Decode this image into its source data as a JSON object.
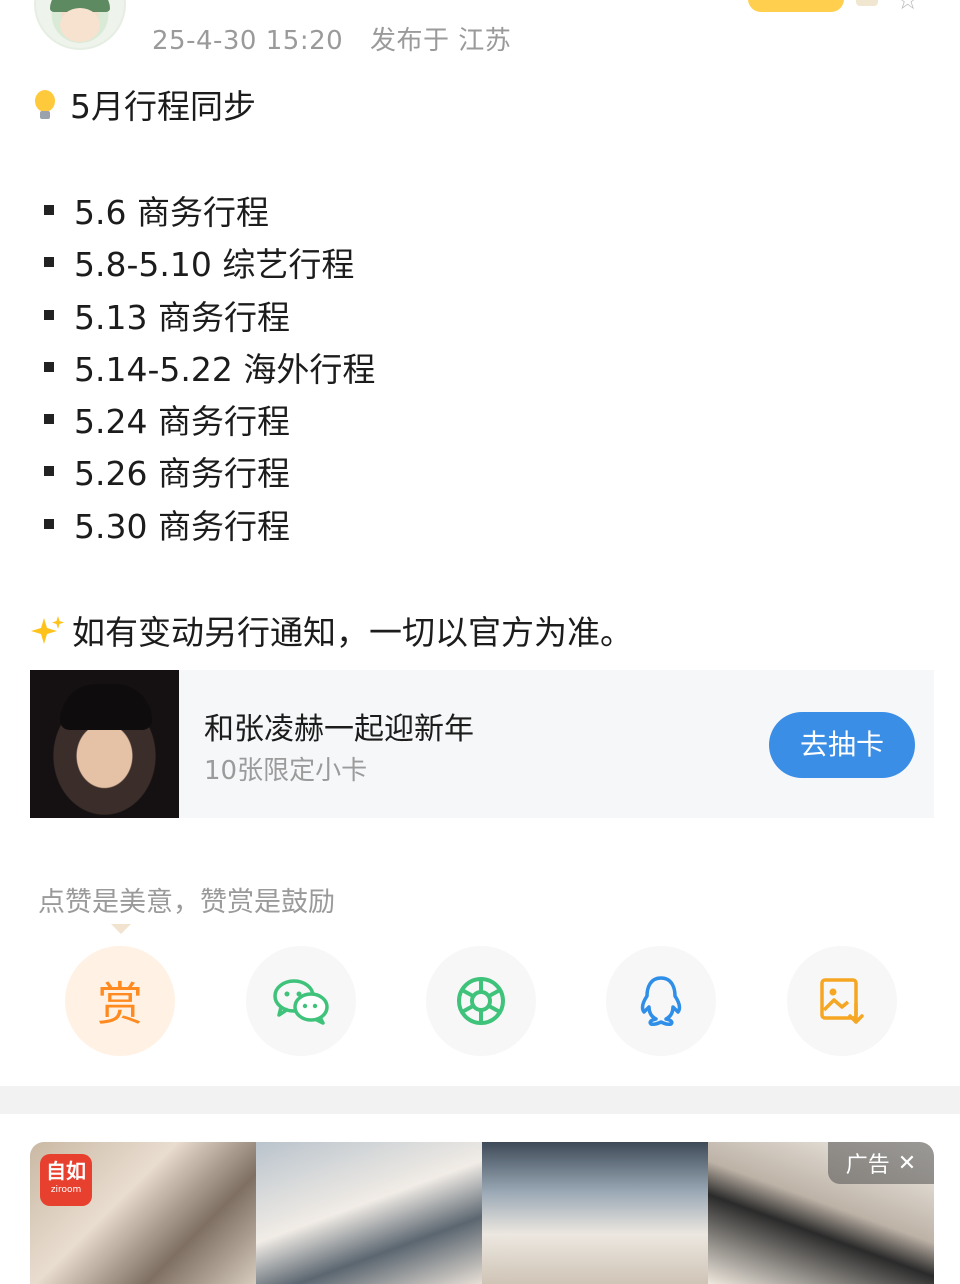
{
  "header": {
    "timestamp": "25-4-30 15:20",
    "location": "发布于 江苏"
  },
  "post": {
    "title": "5月行程同步",
    "schedule": [
      "5.6 商务行程",
      "5.8-5.10 综艺行程",
      "5.13 商务行程",
      "5.14-5.22 海外行程",
      "5.24 商务行程",
      "5.26 商务行程",
      "5.30 商务行程"
    ],
    "notice": "如有变动另行通知，一切以官方为准。"
  },
  "card": {
    "title": "和张凌赫一起迎新年",
    "subtitle": "10张限定小卡",
    "button": "去抽卡"
  },
  "share": {
    "hint": "点赞是美意，赞赏是鼓励",
    "reward_label": "赏",
    "items": [
      "reward-icon",
      "wechat-icon",
      "moments-icon",
      "qq-icon",
      "save-image-icon"
    ],
    "colors": {
      "reward": "#ff8a1f",
      "wechat": "#3fc27a",
      "moments": "#3fc27a",
      "qq": "#2f8ee8",
      "save": "#f5a623"
    }
  },
  "ad": {
    "brand": "自如",
    "brand_sub": "ziroom",
    "tag": "广告"
  },
  "colors": {
    "accent": "#3a8ee6",
    "meta_text": "#9a9a9a"
  }
}
